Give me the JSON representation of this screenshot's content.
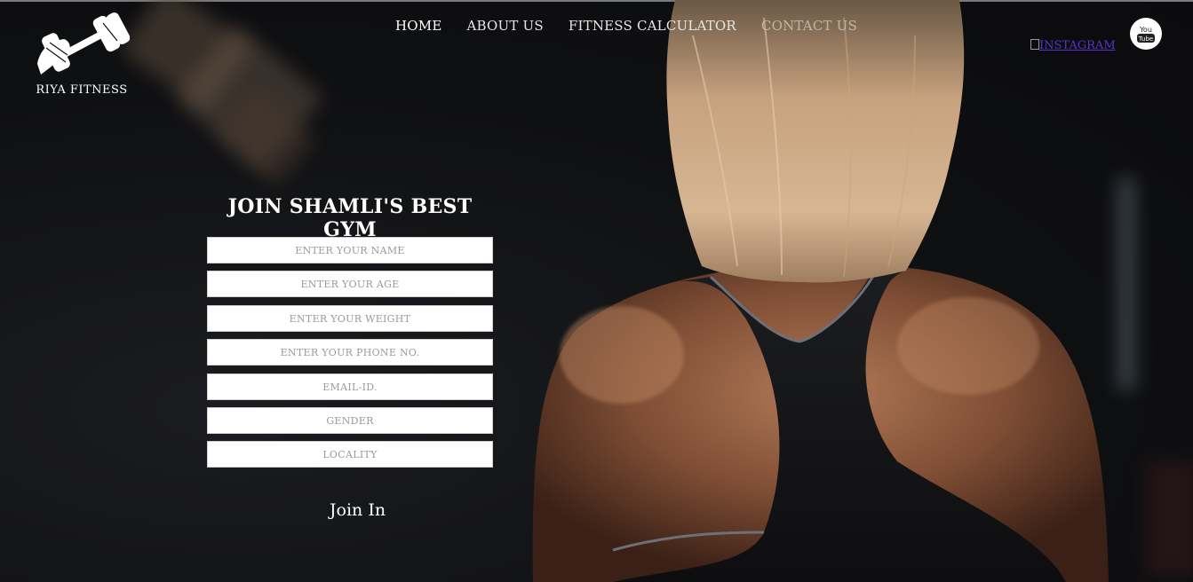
{
  "brand": {
    "name": "RIYA FITNESS",
    "logo_icon": "dumbbell-hand-icon"
  },
  "nav": {
    "items": [
      {
        "label": "HOME",
        "active": true
      },
      {
        "label": "ABOUT US",
        "active": false
      },
      {
        "label": "FITNESS CALCULATOR",
        "active": false
      },
      {
        "label": "CONTACT US",
        "active": false
      }
    ]
  },
  "social": {
    "instagram_alt": "INSTAGRAM",
    "youtube_icon": "youtube-icon",
    "youtube_text_top": "You",
    "youtube_text_bottom": "Tube"
  },
  "form": {
    "title": "JOIN SHAMLI'S BEST GYM",
    "fields": [
      {
        "placeholder": "ENTER YOUR NAME"
      },
      {
        "placeholder": "ENTER YOUR AGE"
      },
      {
        "placeholder": "ENTER YOUR WEIGHT"
      },
      {
        "placeholder": "ENTER YOUR PHONE NO."
      },
      {
        "placeholder": "EMAIL-ID."
      },
      {
        "placeholder": "GENDER"
      },
      {
        "placeholder": "LOCALITY"
      }
    ],
    "submit_label": "Join In"
  },
  "colors": {
    "background": "#111214",
    "text": "#ffffff",
    "link_broken": "#5533cc"
  }
}
